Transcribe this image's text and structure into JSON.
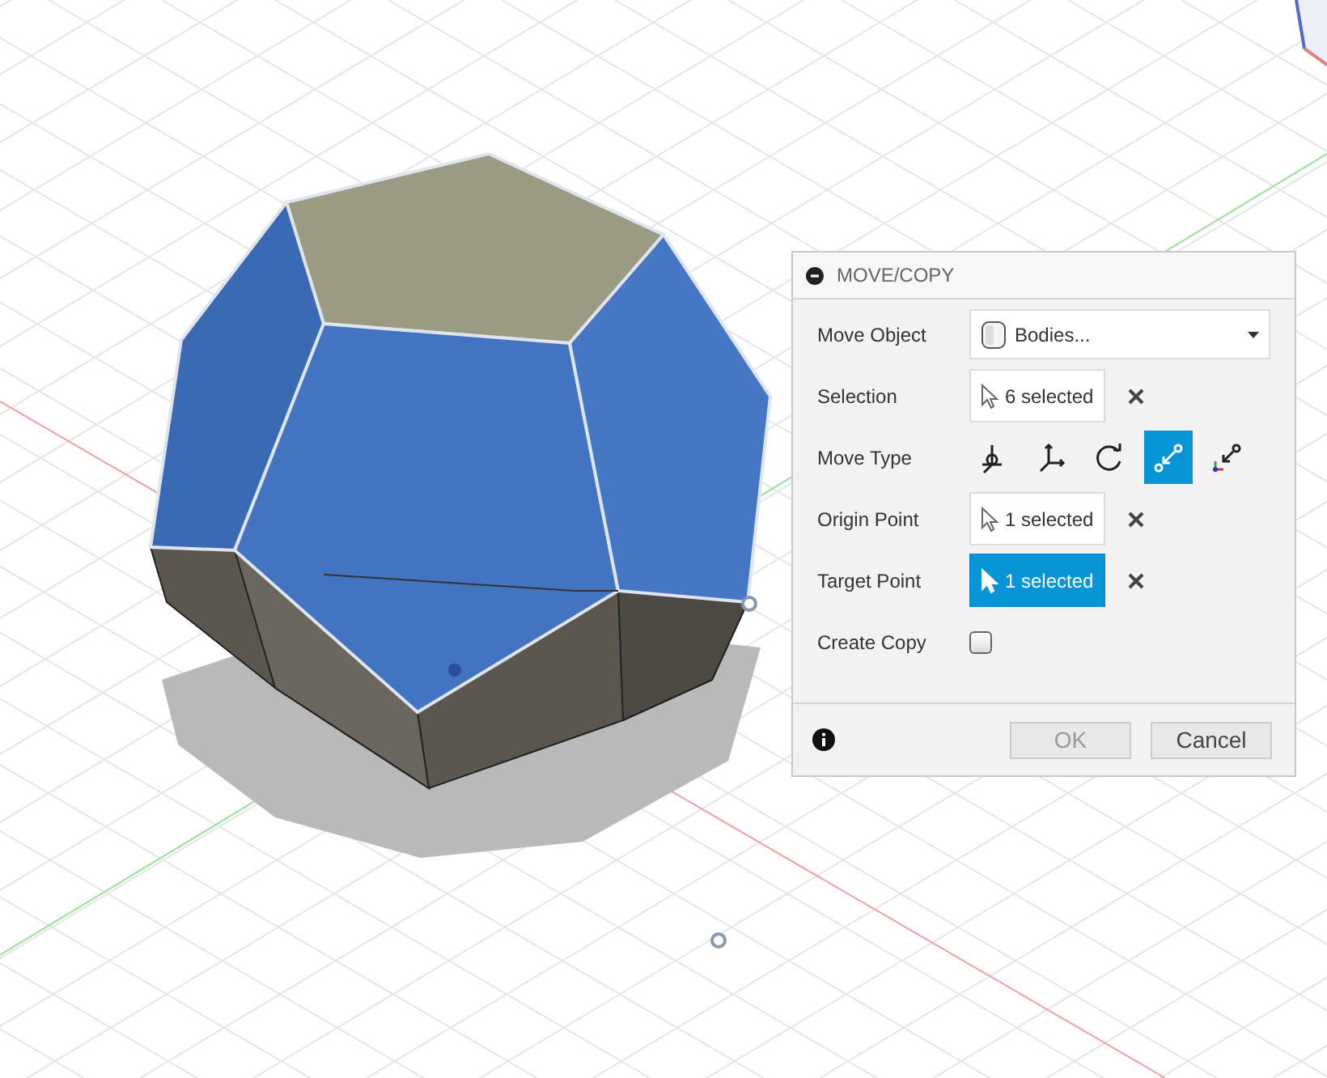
{
  "dialog": {
    "title": "MOVE/COPY",
    "rows": [
      {
        "kind": "dropdown",
        "label": "Move Object",
        "value": "Bodies..."
      },
      {
        "kind": "selection",
        "label": "Selection",
        "value": "6 selected",
        "selected": false
      },
      {
        "kind": "movetype",
        "label": "Move Type",
        "options": [
          {
            "selected": false
          },
          {
            "selected": false
          },
          {
            "selected": false
          },
          {
            "selected": true
          },
          {
            "selected": false
          }
        ]
      },
      {
        "kind": "selection",
        "label": "Origin Point",
        "value": "1 selected",
        "selected": false
      },
      {
        "kind": "selection",
        "label": "Target Point",
        "value": "1 selected",
        "selected": true
      },
      {
        "kind": "checkbox",
        "label": "Create Copy",
        "checked": false
      }
    ],
    "buttons": [
      {
        "label": "OK",
        "disabled": true
      },
      {
        "label": "Cancel",
        "disabled": false
      }
    ]
  }
}
